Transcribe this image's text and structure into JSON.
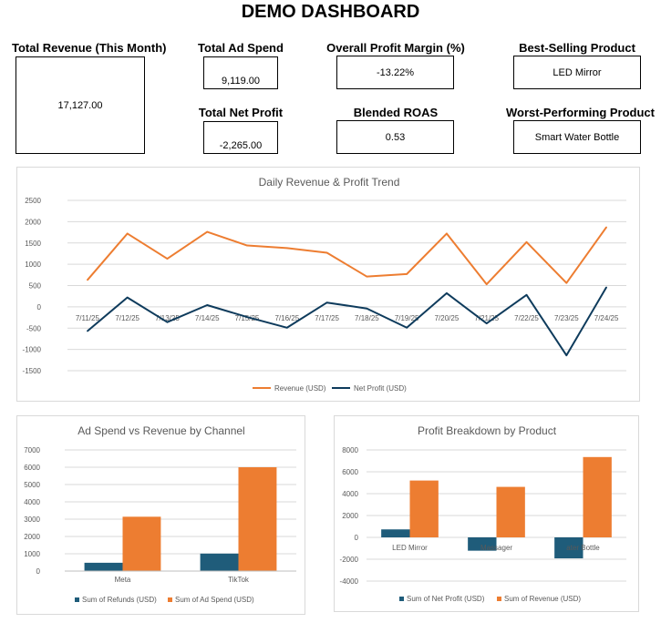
{
  "dashboard_title": "DEMO DASHBOARD",
  "kpis": {
    "total_revenue": {
      "label": "Total Revenue (This Month)",
      "value": "17,127.00"
    },
    "total_ad_spend": {
      "label": "Total Ad Spend",
      "value": "9,119.00"
    },
    "total_net_profit": {
      "label": "Total Net Profit",
      "value": "-2,265.00"
    },
    "overall_profit_margin": {
      "label": "Overall Profit Margin (%)",
      "value": "-13.22%"
    },
    "blended_roas": {
      "label": "Blended ROAS",
      "value": "0.53"
    },
    "best_selling_product": {
      "label": "Best-Selling Product",
      "value": "LED Mirror"
    },
    "worst_performing_product": {
      "label": "Worst-Performing Product",
      "value": "Smart Water Bottle"
    }
  },
  "colors": {
    "orange": "#ED7D31",
    "navy": "#0E3B5C",
    "teal": "#1F5C7A",
    "grid": "#d9d9d9",
    "axis_text": "#595959"
  },
  "chart_data": [
    {
      "type": "line",
      "title": "Daily Revenue & Profit Trend",
      "x": [
        "7/11/25",
        "7/12/25",
        "7/13/25",
        "7/14/25",
        "7/15/25",
        "7/16/25",
        "7/17/25",
        "7/18/25",
        "7/19/25",
        "7/20/25",
        "7/21/25",
        "7/22/25",
        "7/23/25",
        "7/24/25"
      ],
      "series": [
        {
          "name": "Revenue (USD)",
          "color": "#ED7D31",
          "values": [
            630,
            1720,
            1130,
            1760,
            1440,
            1380,
            1270,
            710,
            770,
            1720,
            530,
            1520,
            560,
            1870
          ]
        },
        {
          "name": "Net Profit (USD)",
          "color": "#0E3B5C",
          "values": [
            -570,
            220,
            -360,
            40,
            -240,
            -490,
            100,
            -40,
            -490,
            320,
            -390,
            280,
            -1140,
            460
          ]
        }
      ],
      "ylim": [
        -1500,
        2500
      ],
      "yticks": [
        2500,
        2000,
        1500,
        1000,
        500,
        0,
        -500,
        -1000,
        -1500
      ],
      "grid": true,
      "legend": "bottom"
    },
    {
      "type": "bar",
      "title": "Ad Spend vs Revenue by Channel",
      "categories": [
        "Meta",
        "TikTok"
      ],
      "series": [
        {
          "name": "Sum of Refunds (USD)",
          "color": "#1F5C7A",
          "values": [
            480,
            1010
          ]
        },
        {
          "name": "Sum of Ad Spend (USD)",
          "color": "#ED7D31",
          "values": [
            3140,
            6000
          ]
        }
      ],
      "ylim": [
        0,
        7000
      ],
      "yticks": [
        7000,
        6000,
        5000,
        4000,
        3000,
        2000,
        1000,
        0
      ],
      "grid": true,
      "legend": "bottom"
    },
    {
      "type": "bar",
      "title": "Profit Breakdown by Product",
      "categories": [
        "LED Mirror",
        "Neck Massager",
        "Smart Water Bottle"
      ],
      "category_labels_shown": [
        "LED Mirror",
        "Massager",
        "ater Bottle"
      ],
      "series": [
        {
          "name": "Sum of Net Profit (USD)",
          "color": "#1F5C7A",
          "values": [
            730,
            -1220,
            -1920
          ]
        },
        {
          "name": "Sum of Revenue (USD)",
          "color": "#ED7D31",
          "values": [
            5200,
            4620,
            7350
          ]
        }
      ],
      "ylim": [
        -4000,
        8000
      ],
      "yticks": [
        8000,
        6000,
        4000,
        2000,
        0,
        -2000,
        -4000
      ],
      "grid": true,
      "legend": "bottom"
    }
  ]
}
